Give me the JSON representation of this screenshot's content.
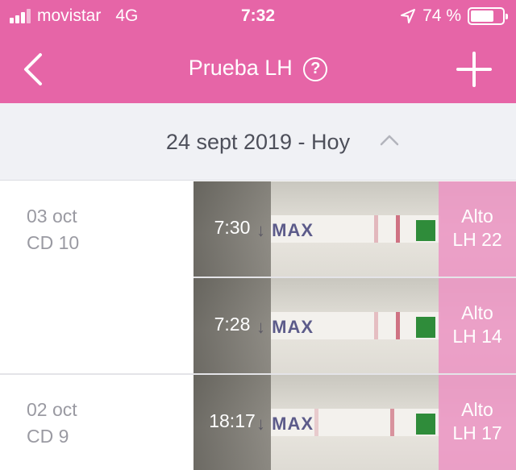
{
  "status_bar": {
    "carrier": "movistar",
    "network": "4G",
    "time": "7:32",
    "battery_percent": "74 %",
    "battery_level": 0.74
  },
  "nav": {
    "title": "Prueba LH",
    "help_symbol": "?"
  },
  "date_range": {
    "label": "24 sept 2019 - Hoy"
  },
  "days": [
    {
      "date": "03 oct",
      "cycle_day": "CD 10",
      "tests": [
        {
          "time": "7:30",
          "result": "Alto",
          "lh": "LH 22"
        },
        {
          "time": "7:28",
          "result": "Alto",
          "lh": "LH 14"
        }
      ]
    },
    {
      "date": "02 oct",
      "cycle_day": "CD 9",
      "tests": [
        {
          "time": "18:17",
          "result": "Alto",
          "lh": "LH 17"
        }
      ]
    }
  ],
  "colors": {
    "brand_pink": "#e665a7",
    "result_pink": "#ec96c4",
    "header_bg": "#f0f1f5",
    "muted_text": "#9a9aa2"
  },
  "icons": {
    "back": "chevron-left-icon",
    "help": "question-circle-icon",
    "add": "plus-icon",
    "collapse": "chevron-up-icon",
    "location": "location-arrow-icon"
  }
}
